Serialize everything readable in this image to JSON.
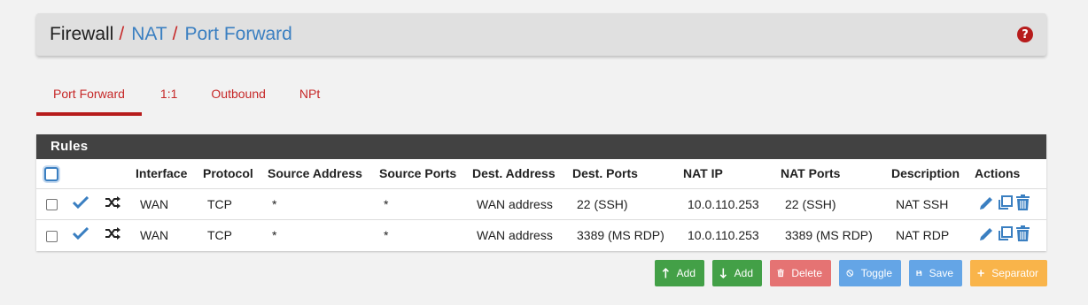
{
  "breadcrumb": {
    "root": "Firewall",
    "sep1": "/",
    "level2": "NAT",
    "sep2": "/",
    "level3": "Port Forward"
  },
  "help": {
    "icon": "question-circle-icon",
    "glyph": "?"
  },
  "tabs": [
    {
      "label": "Port Forward",
      "active": true
    },
    {
      "label": "1:1",
      "active": false
    },
    {
      "label": "Outbound",
      "active": false
    },
    {
      "label": "NPt",
      "active": false
    }
  ],
  "rules": {
    "title": "Rules",
    "columns": [
      "Interface",
      "Protocol",
      "Source Address",
      "Source Ports",
      "Dest. Address",
      "Dest. Ports",
      "NAT IP",
      "NAT Ports",
      "Description",
      "Actions"
    ],
    "rows": [
      {
        "interface": "WAN",
        "protocol": "TCP",
        "src_addr": "*",
        "src_ports": "*",
        "dst_addr": "WAN address",
        "dst_ports": "22 (SSH)",
        "nat_ip": "10.0.110.253",
        "nat_ports": "22 (SSH)",
        "description": "NAT SSH"
      },
      {
        "interface": "WAN",
        "protocol": "TCP",
        "src_addr": "*",
        "src_ports": "*",
        "dst_addr": "WAN address",
        "dst_ports": "3389 (MS RDP)",
        "nat_ip": "10.0.110.253",
        "nat_ports": "3389 (MS RDP)",
        "description": "NAT RDP"
      }
    ]
  },
  "buttons": {
    "add_top": "Add",
    "add_bottom": "Add",
    "delete": "Delete",
    "toggle": "Toggle",
    "save": "Save",
    "separator": "Separator"
  },
  "colors": {
    "accent_red": "#b71c1c",
    "link_blue": "#3a7fc1",
    "green": "#43a047",
    "red": "#e57373",
    "blue": "#64a5e6",
    "orange": "#f9b44a"
  }
}
